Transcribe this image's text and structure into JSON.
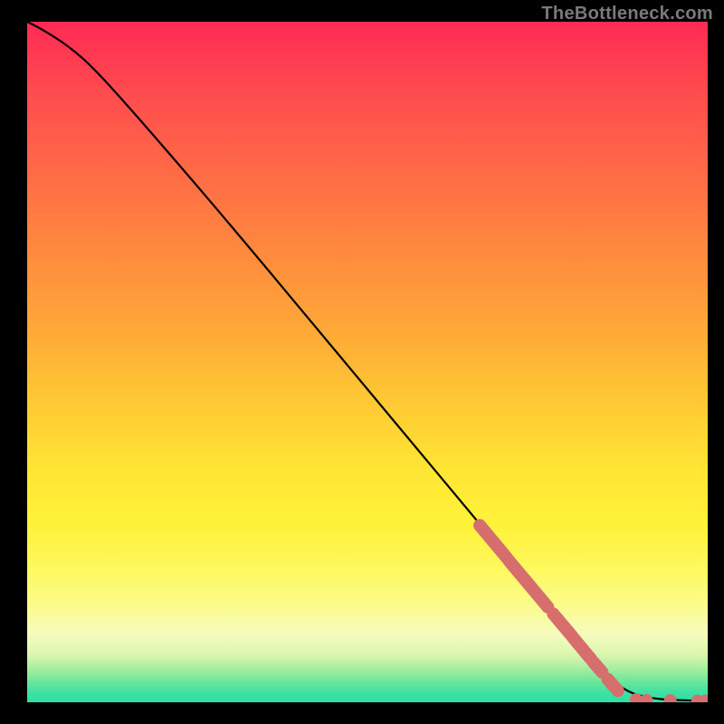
{
  "watermark": "TheBottleneck.com",
  "chart_data": {
    "type": "line",
    "title": "",
    "xlabel": "",
    "ylabel": "",
    "xlim": [
      0,
      100
    ],
    "ylim": [
      0,
      100
    ],
    "grid": false,
    "legend": false,
    "line_points": [
      {
        "x": 0,
        "y": 100
      },
      {
        "x": 2,
        "y": 99
      },
      {
        "x": 6,
        "y": 96.5
      },
      {
        "x": 10,
        "y": 93
      },
      {
        "x": 18,
        "y": 84
      },
      {
        "x": 30,
        "y": 70
      },
      {
        "x": 45,
        "y": 52
      },
      {
        "x": 60,
        "y": 34
      },
      {
        "x": 70,
        "y": 22
      },
      {
        "x": 78,
        "y": 12
      },
      {
        "x": 84,
        "y": 5
      },
      {
        "x": 88,
        "y": 1.5
      },
      {
        "x": 92,
        "y": 0.5
      },
      {
        "x": 96,
        "y": 0.3
      },
      {
        "x": 100,
        "y": 0.2
      }
    ],
    "highlight_segments": [
      {
        "x1": 66.5,
        "y1": 26.0,
        "x2": 70.5,
        "y2": 21.2
      },
      {
        "x1": 70.8,
        "y1": 20.8,
        "x2": 76.5,
        "y2": 14.0
      },
      {
        "x1": 77.3,
        "y1": 13.0,
        "x2": 80.0,
        "y2": 9.8
      },
      {
        "x1": 80.3,
        "y1": 9.4,
        "x2": 82.8,
        "y2": 6.4
      },
      {
        "x1": 83.2,
        "y1": 5.9,
        "x2": 84.5,
        "y2": 4.4
      },
      {
        "x1": 85.3,
        "y1": 3.4,
        "x2": 86.8,
        "y2": 1.7
      }
    ],
    "highlight_points": [
      {
        "x": 89.5,
        "y": 0.4
      },
      {
        "x": 91.0,
        "y": 0.3
      },
      {
        "x": 94.5,
        "y": 0.25
      },
      {
        "x": 98.5,
        "y": 0.2
      },
      {
        "x": 99.7,
        "y": 0.2
      }
    ],
    "colors": {
      "line": "#000000",
      "highlight": "#d66e6e"
    }
  }
}
